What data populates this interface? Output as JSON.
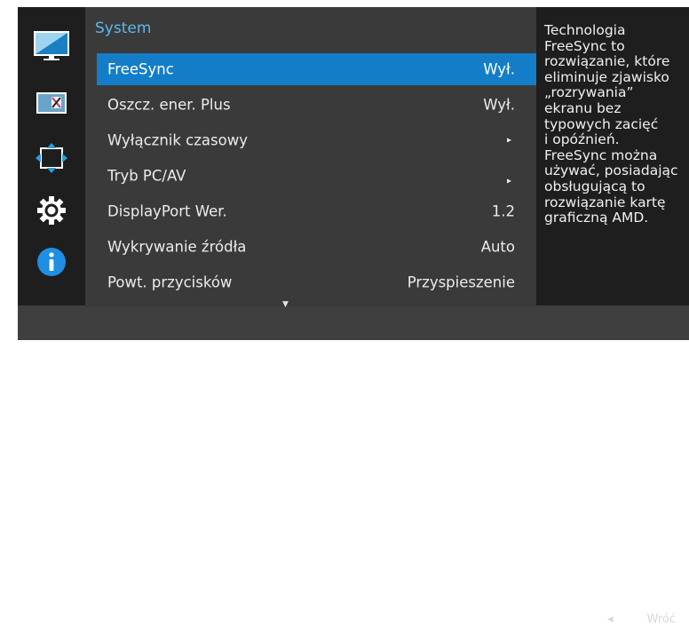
{
  "sidebar": {
    "items": [
      {
        "icon": "picture-icon",
        "selected": true
      },
      {
        "icon": "onscreen-display-icon",
        "selected": false
      },
      {
        "icon": "position-arrows-icon",
        "selected": false
      },
      {
        "icon": "gear-icon",
        "selected": false
      },
      {
        "icon": "info-icon",
        "selected": false
      }
    ]
  },
  "menu": {
    "title": "System",
    "items": [
      {
        "label": "FreeSync",
        "value": "Wył.",
        "selected": true
      },
      {
        "label": "Oszcz. ener. Plus",
        "value": "Wył."
      },
      {
        "label": "Wyłącznik czasowy",
        "arrow": "▸"
      },
      {
        "label": "Tryb PC/AV",
        "arrow": "▸"
      },
      {
        "label": "DisplayPort Wer.",
        "value": "1.2"
      },
      {
        "label": "Wykrywanie źródła",
        "value": "Auto"
      },
      {
        "label": "Powt. przycisków",
        "value": "Przyspieszenie"
      }
    ],
    "scroll_indicator": "▼"
  },
  "help": {
    "text": "Technologia\nFreeSync to\nrozwiązanie, które\neliminuje zjawisko\n„rozrywania”\nekranu bez\ntypowych zacięć\ni opóźnień.\nFreeSync można\nużywać, posiadając\nobsługującą to\nrozwiązanie kartę\ngraficzną AMD."
  },
  "bottom": {
    "back_arrow": "◂",
    "back_label": "Wróć"
  },
  "colors": {
    "accent": "#137ec7",
    "title": "#5cb9ec",
    "background": "#1e1e1e",
    "menu_panel": "#3a3a3a",
    "bottom_bar": "#3f3f3f"
  }
}
